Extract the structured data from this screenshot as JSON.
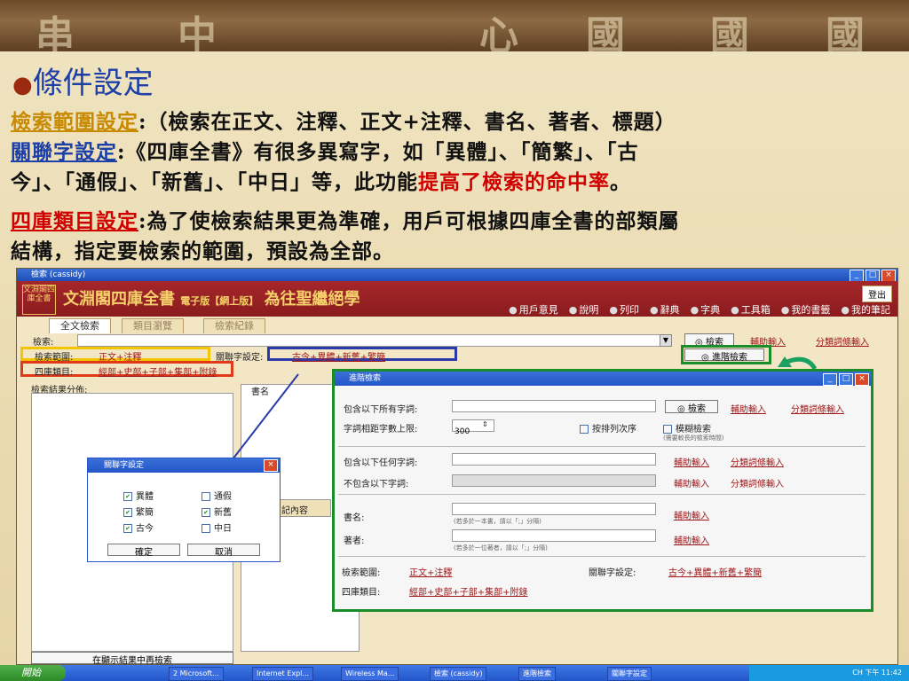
{
  "banner": {
    "chars": [
      "串",
      "中",
      "心",
      "國",
      "國",
      "國"
    ]
  },
  "slide": {
    "title": "條件設定",
    "l1_kw": "檢索範圍設定",
    "l1_rest": ":（檢索在正文、注釋、正文+注釋、書名、著者、標題）",
    "l2_kw": "關聯字設定",
    "l2_rest": ":《四庫全書》有很多異寫字，如「異體」、「簡繁」、「古",
    "l3_pre": "今」、「通假」、「新舊」、「中日」等，此功能",
    "l3_red": "提高了檢索的命中率",
    "l3_post": "。",
    "l4_kw": "四庫類目設定",
    "l4_rest": ":為了使檢索結果更為準確，用戶可根據四庫全書的部類屬",
    "l5": "結構，指定要檢索的範圍，預設為全部。"
  },
  "app": {
    "window_title": "檢索 (cassidy)",
    "logo": "文淵閣四庫全書",
    "brand": "文淵閣四庫全書",
    "brand_sub": "電子版【網上版】",
    "motto": "為往聖繼絕學",
    "logout": "登出",
    "toolbar": [
      "用戶意見",
      "說明",
      "列印",
      "辭典",
      "字典",
      "工具箱",
      "我的書籤",
      "我的筆記"
    ],
    "tabs": [
      "全文檢索",
      "類目瀏覽",
      "檢索紀錄"
    ],
    "search_label": "檢索:",
    "search_button": "檢索",
    "aux_input": "輔助輸入",
    "class_input": "分類詞條輸入",
    "advanced_button": "進階檢索",
    "range_label": "檢索範圍:",
    "range_value": "正文+注釋",
    "rel_label": "關聯字設定:",
    "rel_value": "古今+異體+新舊+繁簡",
    "cat_label": "四庫類目:",
    "cat_value": "經部+史部+子部+集部+附錄",
    "dist_label": "檢索結果分佈:",
    "book_col": "書名",
    "content_col": "記內容",
    "refine_button": "在顯示結果中再檢索"
  },
  "relation_dialog": {
    "title": "關聯字設定",
    "options": [
      {
        "label": "異體",
        "checked": true
      },
      {
        "label": "通假",
        "checked": false
      },
      {
        "label": "繁簡",
        "checked": true
      },
      {
        "label": "新舊",
        "checked": true
      },
      {
        "label": "古今",
        "checked": true
      },
      {
        "label": "中日",
        "checked": false
      }
    ],
    "ok": "確定",
    "cancel": "取消"
  },
  "adv_dialog": {
    "title": "進階檢索",
    "all_words": "包含以下所有字詞:",
    "distance": "字詞相距字數上限:",
    "distance_value": "300",
    "sort_label": "按排列次序",
    "fuzzy_label": "模糊檢索",
    "fuzzy_hint": "(需要較長的檢索時間)",
    "any_words": "包含以下任何字詞:",
    "not_words": "不包含以下字詞:",
    "book_name": "書名:",
    "book_hint": "(若多於一本書，請以「;」分隔)",
    "author": "著者:",
    "author_hint": "(若多於一位著者，請以「;」分隔)",
    "search": "檢索",
    "aux": "輔助輸入",
    "class": "分類詞條輸入",
    "range_label": "檢索範圍:",
    "range_value": "正文+注釋",
    "rel_label": "關聯字設定:",
    "rel_value": "古今+異體+新舊+繁簡",
    "cat_label": "四庫類目:",
    "cat_value": "經部+史部+子部+集部+附錄"
  },
  "taskbar": {
    "start": "開始",
    "tasks": [
      "2 Microsoft...",
      "Internet Expl...",
      "Wireless Ma...",
      "檢索 (cassidy)",
      "進階檢索",
      "關聯字設定"
    ],
    "lang": "CH",
    "clock": "下午 11:42"
  }
}
